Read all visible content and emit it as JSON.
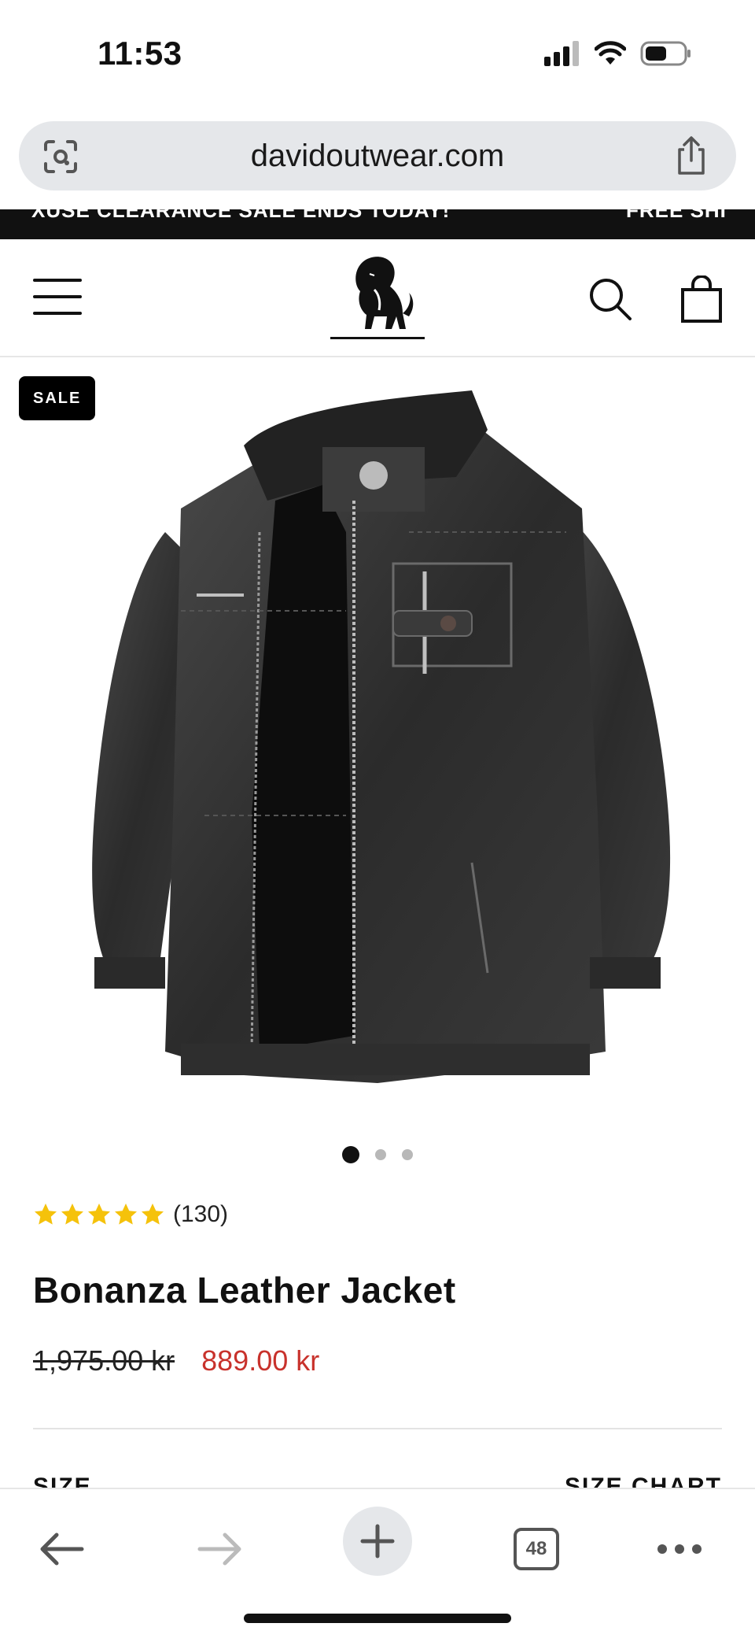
{
  "status_bar": {
    "time": "11:53"
  },
  "browser": {
    "url": "davidoutwear.com",
    "tabs_count": "48"
  },
  "promo": {
    "left_text": "XUSE CLEARANCE SALE ENDS TODAY!",
    "right_text": "FREE SHI"
  },
  "product": {
    "badge": "SALE",
    "rating_value": 5,
    "rating_count": "(130)",
    "title": "Bonanza Leather Jacket",
    "old_price": "1,975.00 kr",
    "new_price": "889.00 kr",
    "image_count": 3,
    "active_image": 1
  },
  "options": {
    "size_label": "SIZE",
    "size_chart_label": "SIZE CHART"
  },
  "colors": {
    "sale_red": "#c8322c",
    "star_yellow": "#f5c20b",
    "promo_bg": "#111111"
  }
}
